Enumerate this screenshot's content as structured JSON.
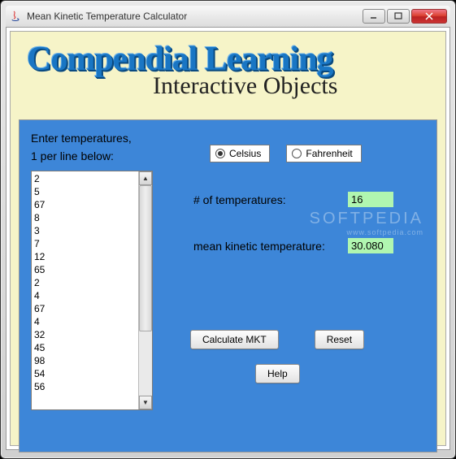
{
  "window": {
    "title": "Mean Kinetic Temperature Calculator"
  },
  "logo": {
    "top": "Compendial Learning",
    "bottom": "Interactive Objects"
  },
  "prompts": {
    "line1": "Enter temperatures,",
    "line2": " 1 per line below:"
  },
  "units": {
    "celsius_label": "Celsius",
    "fahrenheit_label": "Fahrenheit",
    "selected": "celsius"
  },
  "temperatures_text": "2\n5\n67\n8\n3\n7\n12\n65\n2\n4\n67\n4\n32\n45\n98\n54\n56",
  "outputs": {
    "count_label": "# of temperatures:",
    "count_value": "16",
    "mkt_label": "mean kinetic temperature:",
    "mkt_value": "30.080"
  },
  "buttons": {
    "calculate": "Calculate MKT",
    "reset": "Reset",
    "help": "Help"
  },
  "watermark": {
    "line1": "SOFTPEDIA",
    "line2": "www.softpedia.com"
  }
}
